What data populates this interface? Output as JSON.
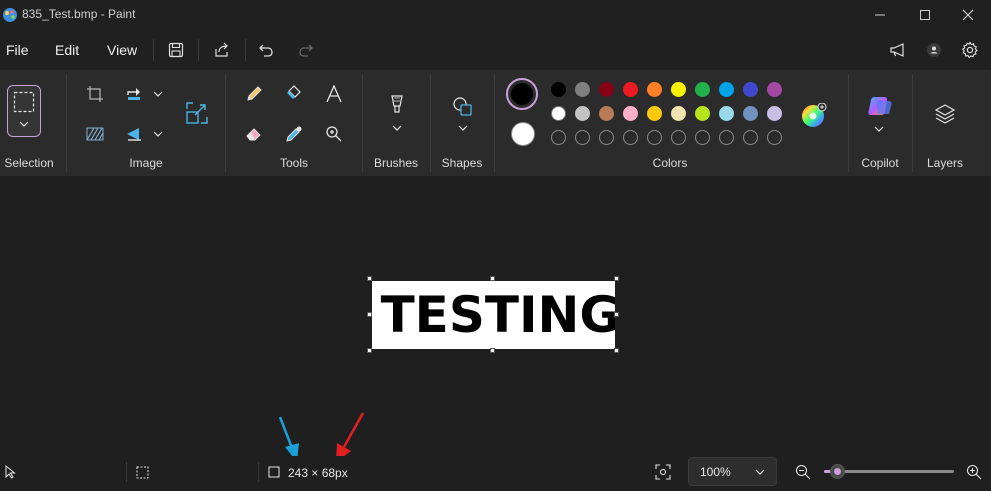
{
  "window": {
    "title": "835_Test.bmp - Paint"
  },
  "menu": {
    "file": "File",
    "edit": "Edit",
    "view": "View"
  },
  "ribbon": {
    "groups": {
      "selection": "Selection",
      "image": "Image",
      "tools": "Tools",
      "brushes": "Brushes",
      "shapes": "Shapes",
      "colors": "Colors",
      "copilot": "Copilot",
      "layers": "Layers"
    },
    "colors": {
      "primary": "#000000",
      "secondary": "#ffffff",
      "row1": [
        "#000000",
        "#7f7f7f",
        "#880015",
        "#ed1c24",
        "#ff7f27",
        "#fff200",
        "#22b14c",
        "#00a2e8",
        "#3f48cc",
        "#a349a4"
      ],
      "row2": [
        "#ffffff",
        "#c3c3c3",
        "#b97a57",
        "#ffaec9",
        "#ffc90e",
        "#efe4b0",
        "#b5e61d",
        "#99d9ea",
        "#7092be",
        "#c8bfe7"
      ],
      "row3_empty_count": 10
    }
  },
  "canvas": {
    "text": "TESTING"
  },
  "status": {
    "selection_size": "243 × 68px",
    "zoom": "100%",
    "zoom_level": 0.2
  },
  "theme": {
    "accent": "#c9a0dc",
    "background": "#1f1f1f",
    "ribbon": "#2b2b2b",
    "arrow_blue": "#1a9fd6",
    "arrow_red": "#e02020"
  },
  "icons": [
    "paint-app-icon",
    "minimize-icon",
    "maximize-icon",
    "close-icon",
    "save-icon",
    "share-icon",
    "undo-icon",
    "redo-icon",
    "megaphone-icon",
    "account-icon",
    "settings-icon",
    "crop-icon",
    "rotate-icon",
    "chevron-down-icon",
    "resize-icon",
    "flip-icon",
    "remove-background-icon",
    "pencil-icon",
    "fill-icon",
    "text-icon",
    "eraser-icon",
    "color-picker-icon",
    "magnifier-icon",
    "brush-icon",
    "shapes-icon",
    "edit-colors-icon",
    "copilot-icon",
    "layers-icon",
    "cursor-icon",
    "selection-icon",
    "canvas-size-icon",
    "fit-to-window-icon",
    "zoom-out-icon",
    "zoom-in-icon"
  ]
}
